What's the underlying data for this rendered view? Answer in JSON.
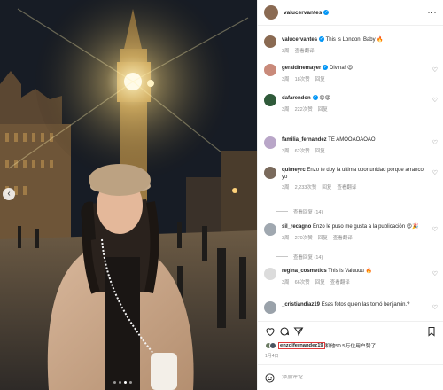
{
  "post": {
    "author": "valucervantes",
    "more_icon": "ellipsis-icon"
  },
  "comments": [
    {
      "user": "valucervantes",
      "text": "This is London. Baby 🔥",
      "time": "3周",
      "likes": "",
      "reply": "",
      "translate": "查看翻译",
      "verified": true,
      "avatar": "#8a6a52",
      "heart": false
    },
    {
      "user": "geraldinemayer",
      "text": "Divina! 😍",
      "time": "3周",
      "likes": "18次赞",
      "reply": "回复",
      "translate": "",
      "verified": true,
      "avatar": "#c98a7a",
      "heart": true
    },
    {
      "user": "dafarendon",
      "text": "😍😍",
      "time": "3周",
      "likes": "222次赞",
      "reply": "回复",
      "translate": "",
      "verified": true,
      "avatar": "#2f5a3a",
      "heart": true
    },
    {
      "user": "familia_fernandez",
      "text": "TE AMOOAOAOAO",
      "time": "3周",
      "likes": "62次赞",
      "reply": "回复",
      "translate": "",
      "verified": false,
      "avatar": "#b9a6c8",
      "heart": true
    },
    {
      "user": "quimeyrc",
      "text": "Enzo te doy la ultima oportunidad porque arranco yo",
      "time": "3周",
      "likes": "2,233次赞",
      "reply": "回复",
      "translate": "查看翻译",
      "verified": false,
      "avatar": "#7a6a5c",
      "heart": true
    },
    {
      "user": "sil_recagno",
      "text": "Enzo le puso me gusta a la publicación 😍🎉",
      "time": "3周",
      "likes": "270次赞",
      "reply": "回复",
      "translate": "查看翻译",
      "verified": false,
      "avatar": "#a0a8b0",
      "heart": true
    },
    {
      "user": "regina_cosmetics",
      "text": "This is Valuuuu 🔥",
      "time": "3周",
      "likes": "66次赞",
      "reply": "回复",
      "translate": "查看翻译",
      "verified": false,
      "avatar": "#dcdcdc",
      "heart": true
    },
    {
      "user": "_cristiandiaz19",
      "text": "Esas fotos quien las tomó benjamin.?",
      "time": "",
      "likes": "",
      "reply": "",
      "translate": "",
      "verified": false,
      "avatar": "#9aa2aa",
      "heart": true
    }
  ],
  "view_replies": {
    "quimeyrc": "查看回复 (14)",
    "sil_recagno": "查看回复 (14)"
  },
  "likes_line": {
    "user": "enzojfernandez19",
    "rest": "和他50.5万位用户赞了"
  },
  "date": "1月4日",
  "add_comment": {
    "placeholder": "添加评论..."
  },
  "icons": [
    "heart-icon",
    "comment-icon",
    "share-icon",
    "bookmark-icon",
    "emoji-icon",
    "chevron-left-icon"
  ],
  "carousel": {
    "total": 4,
    "active": 2
  },
  "colors": {
    "verified": "#0095f6",
    "highlight": "#e03a3a",
    "muted": "#8e8e8e"
  }
}
